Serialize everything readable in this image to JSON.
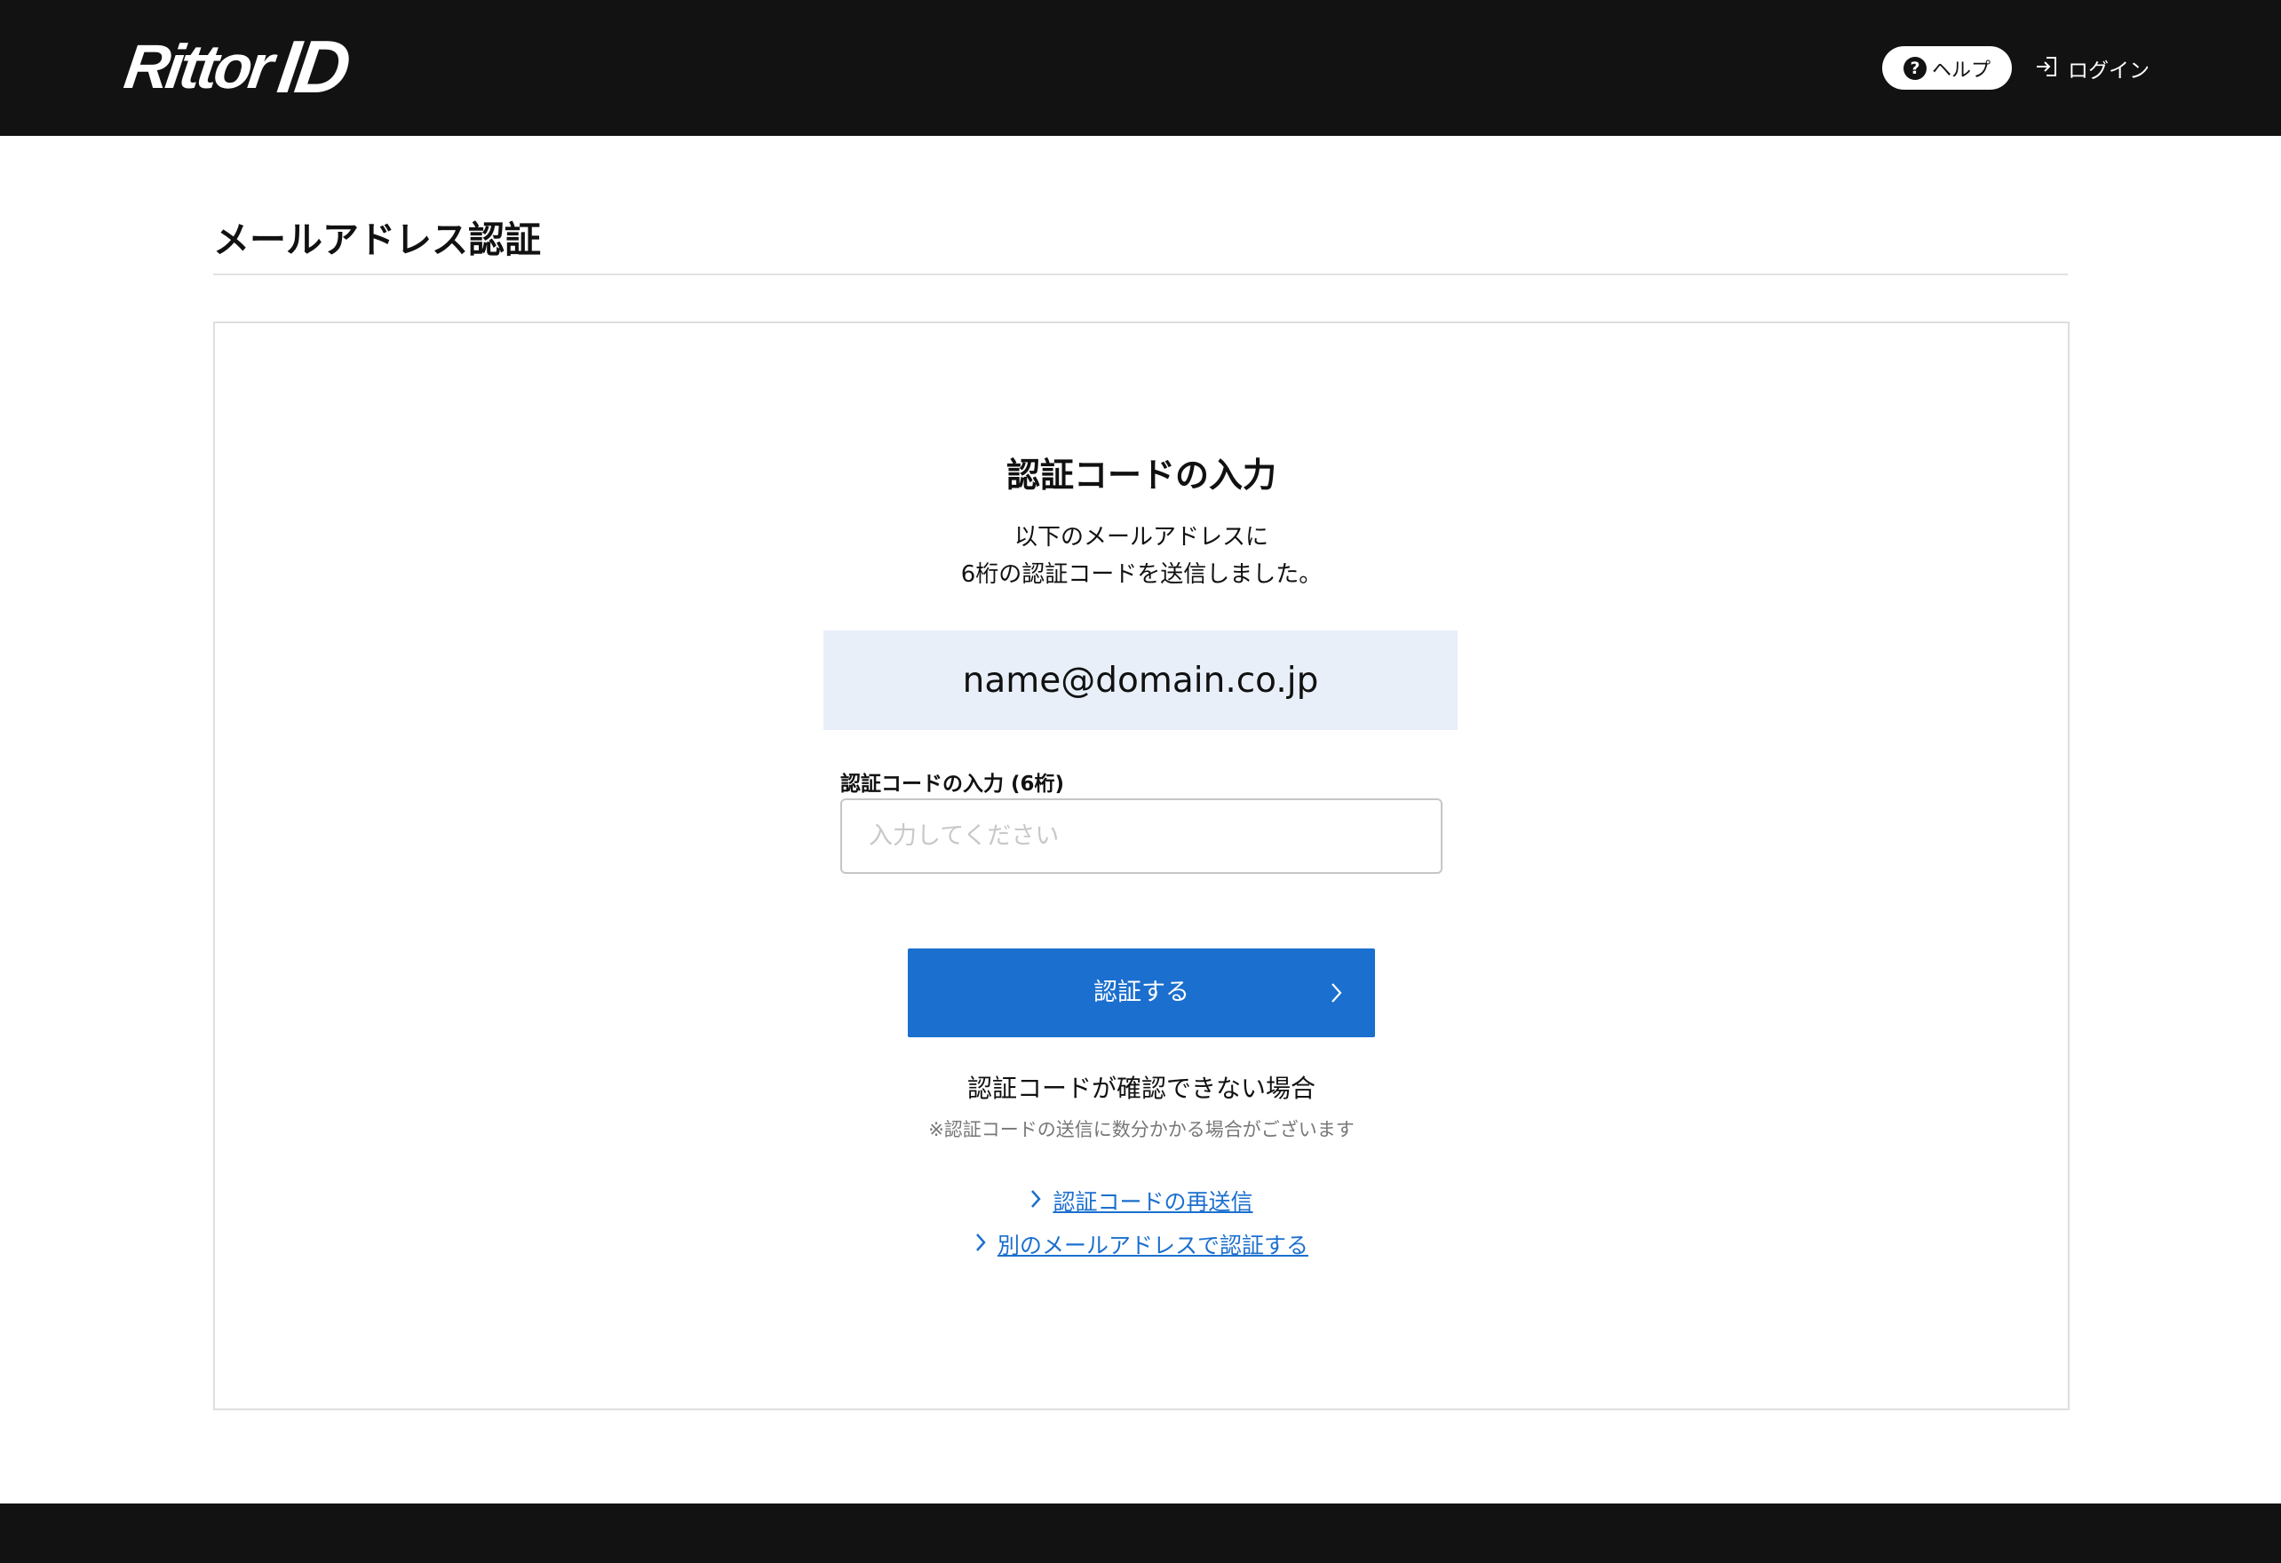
{
  "header": {
    "logo_brand": "Rittor",
    "logo_id": "ID",
    "help_label": "ヘルプ",
    "help_icon_glyph": "?",
    "login_label": "ログイン"
  },
  "page": {
    "title": "メールアドレス認証"
  },
  "card": {
    "title": "認証コードの入力",
    "description_line1": "以下のメールアドレスに",
    "description_line2": "6桁の認証コードを送信しました。",
    "email": "name@domain.co.jp",
    "code_label": "認証コードの入力 (6桁)",
    "code_placeholder": "入力してください",
    "code_value": "",
    "verify_button": "認証する",
    "trouble_title": "認証コードが確認できない場合",
    "trouble_note": "※認証コードの送信に数分かかる場合がございます",
    "links": {
      "resend": "認証コードの再送信",
      "other_email": "別のメールアドレスで認証する"
    }
  },
  "colors": {
    "header_bg": "#121212",
    "accent": "#1b6fce",
    "email_box_bg": "#e8eff9"
  },
  "icons": {
    "help": "question-circle-icon",
    "login": "login-arrow-icon",
    "button_chevron": "chevron-right-icon",
    "link_chevron": "chevron-right-icon"
  }
}
